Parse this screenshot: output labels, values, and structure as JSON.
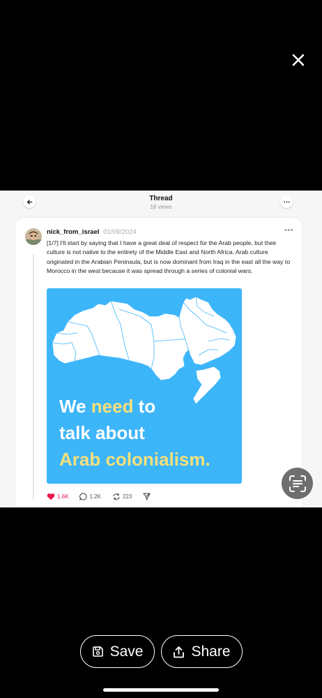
{
  "header": {
    "title": "Thread",
    "views": "18 views"
  },
  "post": {
    "username": "nick_from_israel",
    "date": "01/09/2024",
    "more": "•••",
    "text": "[1/7] I'll start by saying that I have a great deal of respect for the Arab people, but their culture is not native to the entirety of the Middle East and North Africa. Arab culture originated in the Arabian Peninsula, but is now dominant from Iraq in the east all the way to Morocco in the west because it was spread through a series of colonial wars.",
    "image": {
      "line1_a": "We ",
      "line1_b": "need",
      "line1_c": " to",
      "line2": "talk about",
      "line3": "Arab colonialism.",
      "bg_color": "#3db5f9",
      "highlight_color": "#f5e07a"
    },
    "likes": "1.6K",
    "comments": "1.2K",
    "reposts": "223",
    "like_color": "#e8194a"
  },
  "bottom_bar": {
    "save_label": "Save",
    "share_label": "Share"
  },
  "icons": {
    "close": "close-icon",
    "back": "back-arrow-icon",
    "more": "more-icon",
    "heart": "heart-icon",
    "comment": "comment-icon",
    "repost": "repost-icon",
    "send": "send-icon",
    "scan": "text-scan-icon",
    "save": "save-icon",
    "share": "share-icon"
  }
}
